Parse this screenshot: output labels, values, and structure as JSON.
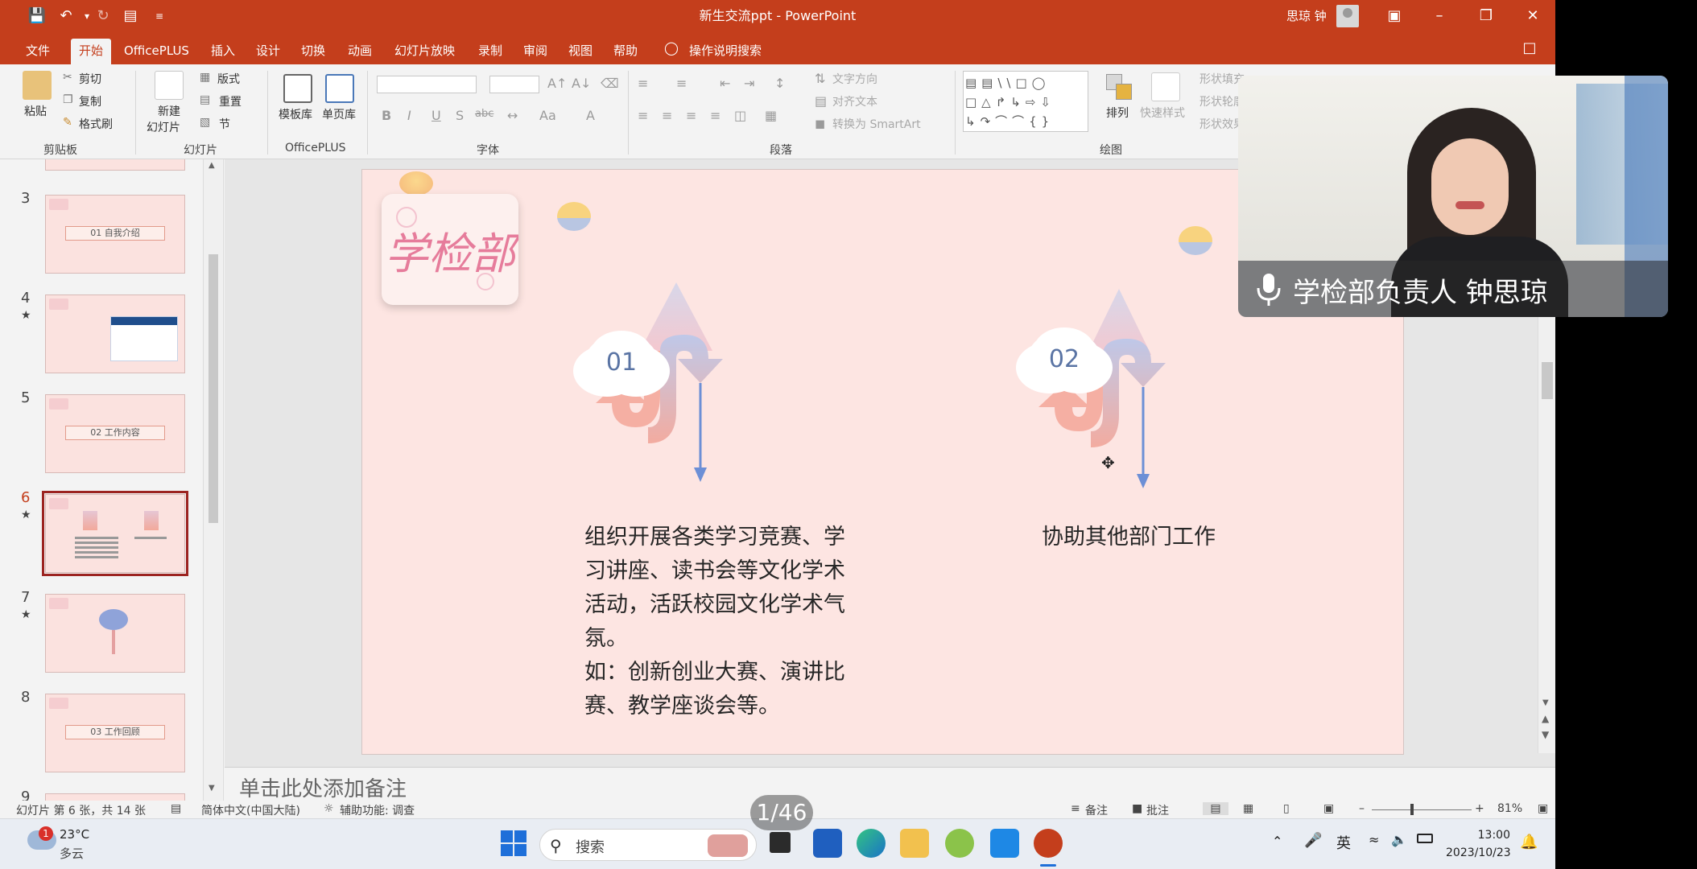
{
  "window": {
    "doc_title": "新生交流ppt - PowerPoint",
    "user_name": "思琼 钟"
  },
  "menu": {
    "tabs": [
      "文件",
      "开始",
      "OfficePLUS",
      "插入",
      "设计",
      "切换",
      "动画",
      "幻灯片放映",
      "录制",
      "审阅",
      "视图",
      "帮助"
    ],
    "active_tab": "开始",
    "tell_me": "操作说明搜索"
  },
  "ribbon": {
    "clipboard": {
      "paste": "粘贴",
      "cut": "剪切",
      "copy": "复制",
      "format_painter": "格式刷",
      "label": "剪贴板"
    },
    "slides": {
      "new_slide_1": "新建",
      "new_slide_2": "幻灯片",
      "layout": "版式",
      "reset": "重置",
      "section": "节",
      "label": "幻灯片"
    },
    "officeplus": {
      "template": "模板库",
      "single_page": "单页库",
      "label": "OfficePLUS"
    },
    "font": {
      "label": "字体",
      "bold": "B",
      "italic": "I",
      "underline": "U",
      "strike": "S",
      "abc": "abc",
      "aa": "Aa",
      "a_color": "A"
    },
    "paragraph": {
      "text_direction": "文字方向",
      "align_text": "对齐文本",
      "smartart": "转换为 SmartArt",
      "label": "段落"
    },
    "drawing": {
      "arrange": "排列",
      "quick_styles": "快速样式",
      "shape_fill": "形状填充",
      "shape_outline": "形状轮廓",
      "shape_effects": "形状效果",
      "label": "绘图"
    }
  },
  "thumbnails": [
    {
      "num": "3",
      "star": "",
      "text": "01    自我介绍"
    },
    {
      "num": "4",
      "star": "★",
      "text": ""
    },
    {
      "num": "5",
      "star": "",
      "text": "02    工作内容"
    },
    {
      "num": "6",
      "star": "★",
      "text": ""
    },
    {
      "num": "7",
      "star": "★",
      "text": ""
    },
    {
      "num": "8",
      "star": "",
      "text": "03    工作回顾"
    },
    {
      "num": "9",
      "star": "",
      "text": ""
    }
  ],
  "slide": {
    "logo_text": "学检部",
    "item1_num": "01",
    "item2_num": "02",
    "item1_lines": [
      "组织开展各类学习竞赛、学",
      "习讲座、读书会等文化学术",
      "活动，活跃校园文化学术气",
      "氛。",
      "如：创新创业大赛、演讲比",
      "赛、教学座谈会等。"
    ],
    "item2_text": "协助其他部门工作"
  },
  "notes_placeholder": "单击此处添加备注",
  "status": {
    "slide_info": "幻灯片 第 6 张，共 14 张",
    "language": "简体中文(中国大陆)",
    "accessibility": "辅助功能: 调查",
    "notes": "备注",
    "comments": "批注",
    "zoom": "81%"
  },
  "overlay": {
    "cam_caption": "学检部负责人 钟思琼",
    "page_indicator": "1/46"
  },
  "taskbar": {
    "weather_temp": "23°C",
    "weather_desc": "多云",
    "weather_badge": "1",
    "search": "搜索",
    "ime": "英",
    "time": "13:00",
    "date": "2023/10/23"
  }
}
